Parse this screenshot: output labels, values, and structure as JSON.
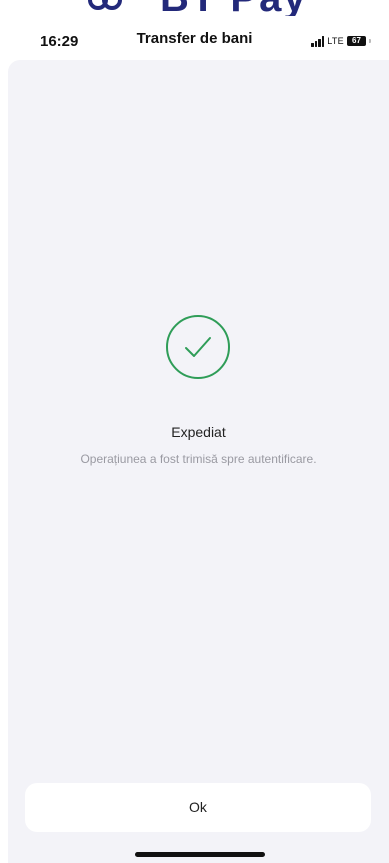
{
  "brand": {
    "text": "BT Pay"
  },
  "status_bar": {
    "time": "16:29",
    "network": "LTE",
    "battery": "67"
  },
  "header": {
    "title": "Transfer de bani"
  },
  "result": {
    "icon": "checkmark-circle",
    "status": "Expediat",
    "message": "Operațiunea a fost trimisă spre autentificare."
  },
  "actions": {
    "ok_label": "Ok"
  },
  "colors": {
    "success": "#2f9d58",
    "background": "#f3f3f8",
    "brand": "#23297a"
  }
}
